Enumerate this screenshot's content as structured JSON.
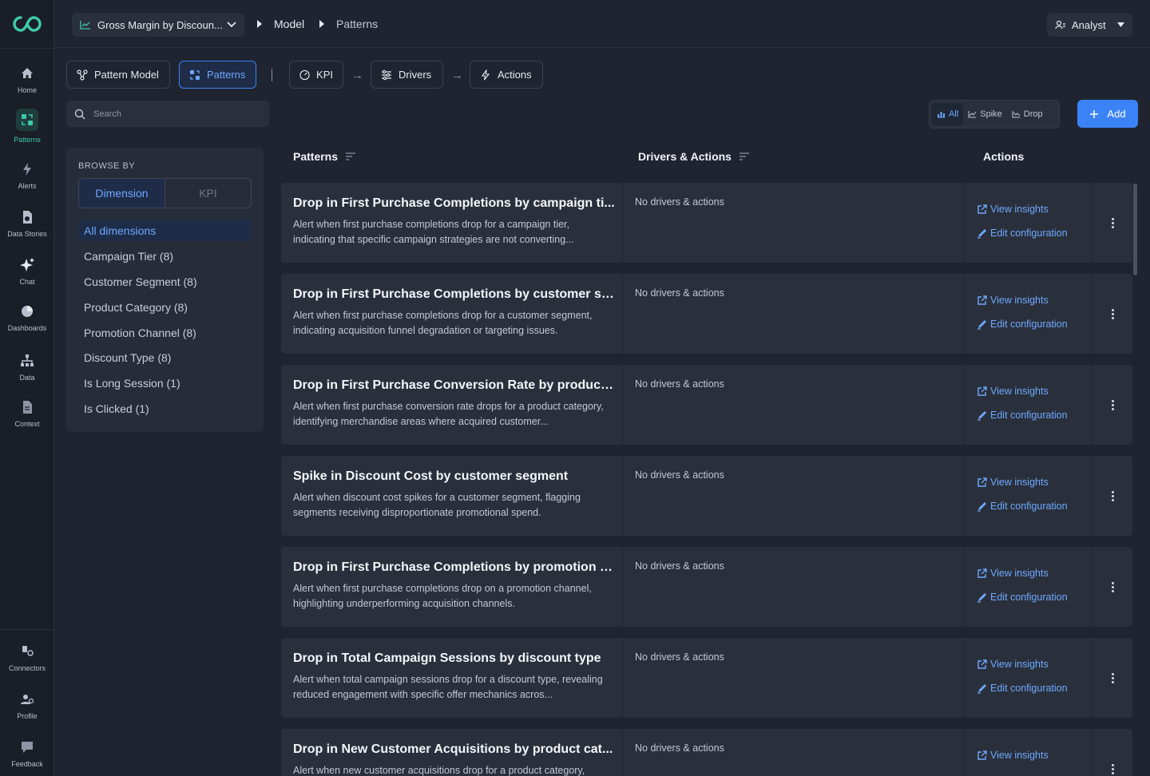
{
  "nav": {
    "items": [
      {
        "label": "Home",
        "icon": "home-icon"
      },
      {
        "label": "Patterns",
        "icon": "patterns-icon",
        "active": true
      },
      {
        "label": "Alerts",
        "icon": "lightning-icon"
      },
      {
        "label": "Data Stories",
        "icon": "data-stories-icon"
      },
      {
        "label": "Chat",
        "icon": "sparkle-icon"
      },
      {
        "label": "Dashboards",
        "icon": "pie-chart-icon"
      },
      {
        "label": "Data",
        "icon": "hierarchy-icon"
      },
      {
        "label": "Context",
        "icon": "document-icon"
      }
    ],
    "bottom": [
      {
        "label": "Connectors",
        "icon": "connectors-icon"
      },
      {
        "label": "Profile",
        "icon": "profile-icon"
      },
      {
        "label": "Feedback",
        "icon": "feedback-icon"
      }
    ]
  },
  "topbar": {
    "dataset": "Gross Margin by Discoun...",
    "breadcrumb": [
      "Model",
      "Patterns"
    ],
    "user": "Analyst"
  },
  "tabs": {
    "pattern_model": "Pattern Model",
    "patterns": "Patterns",
    "kpi": "KPI",
    "drivers": "Drivers",
    "actions": "Actions"
  },
  "search": {
    "placeholder": "Search"
  },
  "filters": {
    "all": "All",
    "spike": "Spike",
    "drop": "Drop"
  },
  "add_label": "Add",
  "browse": {
    "title": "BROWSE BY",
    "toggle": [
      "Dimension",
      "KPI"
    ],
    "dimensions": [
      "All dimensions",
      "Campaign Tier (8)",
      "Customer Segment (8)",
      "Product Category (8)",
      "Promotion Channel (8)",
      "Discount Type (8)",
      "Is Long Session (1)",
      "Is Clicked (1)"
    ]
  },
  "table": {
    "headers": {
      "patterns": "Patterns",
      "drivers": "Drivers & Actions",
      "actions": "Actions"
    },
    "view_label": "View insights",
    "edit_label": "Edit configuration",
    "rows": [
      {
        "title": "Drop in First Purchase Completions by campaign ti...",
        "desc": "Alert when first purchase completions drop for a campaign tier, indicating that specific campaign strategies are not converting...",
        "drivers": "No drivers & actions"
      },
      {
        "title": "Drop in First Purchase Completions by customer se...",
        "desc": "Alert when first purchase completions drop for a customer segment, indicating acquisition funnel degradation or targeting issues.",
        "drivers": "No drivers & actions"
      },
      {
        "title": "Drop in First Purchase Conversion Rate by product ...",
        "desc": "Alert when first purchase conversion rate drops for a product category, identifying merchandise areas where acquired customer...",
        "drivers": "No drivers & actions"
      },
      {
        "title": "Spike in Discount Cost by customer segment",
        "desc": "Alert when discount cost spikes for a customer segment, flagging segments receiving disproportionate promotional spend.",
        "drivers": "No drivers & actions"
      },
      {
        "title": "Drop in First Purchase Completions by promotion c...",
        "desc": "Alert when first purchase completions drop on a promotion channel, highlighting underperforming acquisition channels.",
        "drivers": "No drivers & actions"
      },
      {
        "title": "Drop in Total Campaign Sessions by discount type",
        "desc": "Alert when total campaign sessions drop for a discount type, revealing reduced engagement with specific offer mechanics acros...",
        "drivers": "No drivers & actions"
      },
      {
        "title": "Drop in New Customer Acquisitions by product cat...",
        "desc": "Alert when new customer acquisitions drop for a product category,",
        "drivers": "No drivers & actions"
      }
    ]
  },
  "colors": {
    "accent": "#3b82f6",
    "brand": "#3ec9a7",
    "link": "#6ea8ff",
    "bg": "#1f2430",
    "panel": "#2a303b"
  }
}
